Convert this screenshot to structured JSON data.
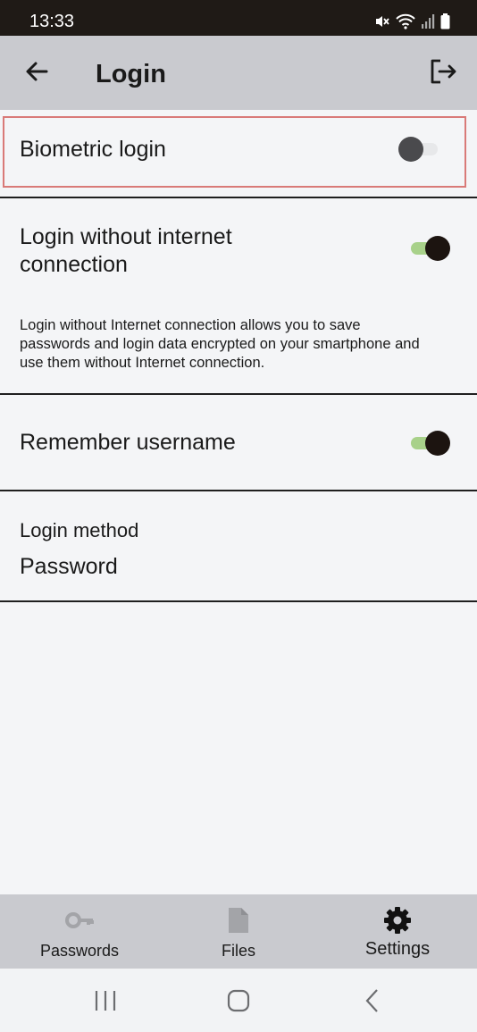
{
  "status_bar": {
    "time": "13:33",
    "icons": [
      "mute-icon",
      "wifi-icon",
      "signal-icon",
      "battery-icon"
    ]
  },
  "app_bar": {
    "title": "Login",
    "back_icon": "arrow-left-icon",
    "logout_icon": "logout-icon"
  },
  "settings": {
    "biometric": {
      "label": "Biometric login",
      "enabled": false
    },
    "offline": {
      "label_line1": "Login without internet",
      "label_line2": "connection",
      "enabled": true,
      "description_lines": [
        "Login without Internet connection allows you to save",
        "passwords and login data encrypted on your smartphone and",
        "use them without Internet connection."
      ]
    },
    "remember": {
      "label": "Remember username",
      "enabled": true
    },
    "method": {
      "label": "Login method",
      "value": "Password"
    }
  },
  "bottom_nav": {
    "items": [
      {
        "label": "Passwords",
        "icon": "key-icon",
        "active": false
      },
      {
        "label": "Files",
        "icon": "file-icon",
        "active": false
      },
      {
        "label": "Settings",
        "icon": "gear-icon",
        "active": true
      }
    ]
  },
  "colors": {
    "status_bar": "#1f1a16",
    "app_bar": "#c9cacf",
    "background": "#f4f5f7",
    "toggle_on_track": "#a8d18a",
    "toggle_thumb_on": "#1c1410",
    "highlight": "#d97a78"
  }
}
